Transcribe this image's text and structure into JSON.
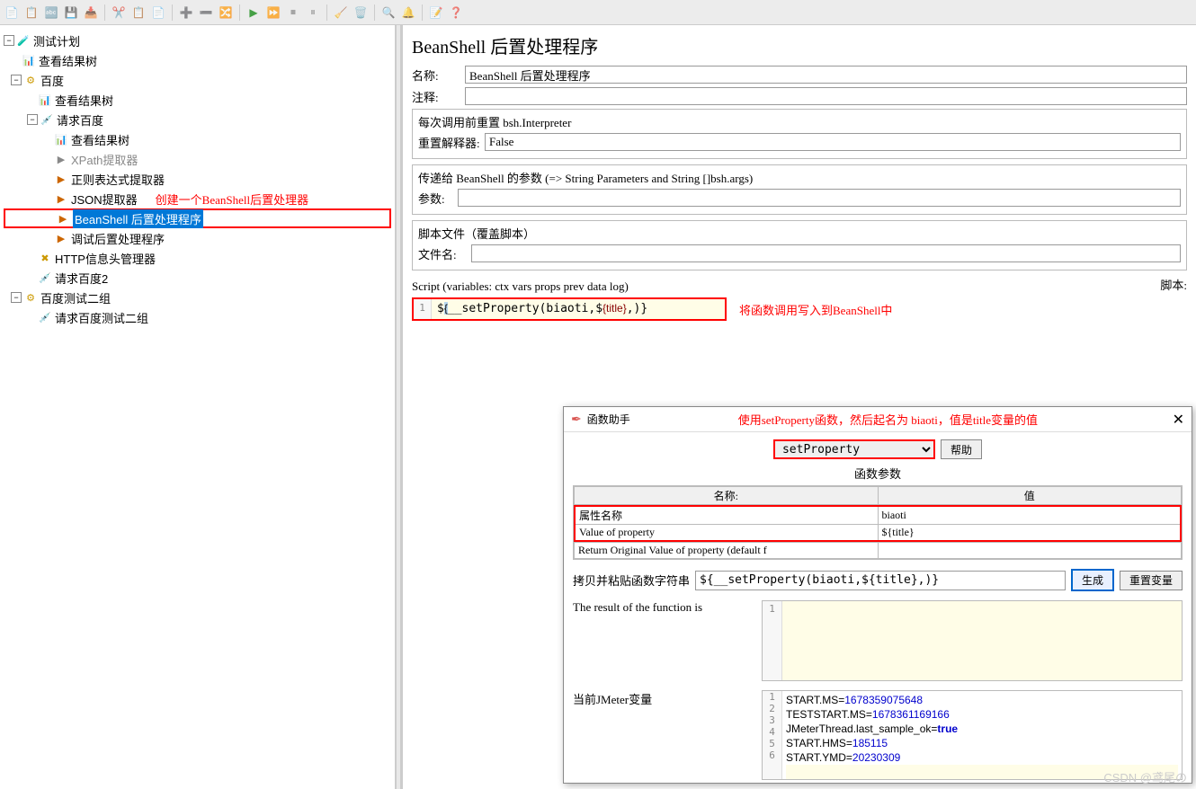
{
  "tree": {
    "root": "测试计划",
    "n1": "查看结果树",
    "n2": "百度",
    "n3": "查看结果树",
    "n4": "请求百度",
    "n5": "查看结果树",
    "n6": "XPath提取器",
    "n7": "正则表达式提取器",
    "n8": "JSON提取器",
    "n9": "BeanShell 后置处理程序",
    "n10": "调试后置处理程序",
    "n11": "HTTP信息头管理器",
    "n12": "请求百度2",
    "n13": "百度测试二组",
    "n14": "请求百度测试二组"
  },
  "annotations": {
    "a1": "创建一个BeanShell后置处理器",
    "a2": "将函数调用写入到BeanShell中",
    "a3": "使用setProperty函数，然后起名为 biaoti，值是title变量的值"
  },
  "panel": {
    "title": "BeanShell 后置处理程序",
    "name_label": "名称:",
    "name_value": "BeanShell 后置处理程序",
    "comment_label": "注释:",
    "comment_value": "",
    "group1_title": "每次调用前重置 bsh.Interpreter",
    "reset_label": "重置解释器:",
    "reset_value": "False",
    "group2_title": "传递给 BeanShell 的参数 (=> String Parameters and String []bsh.args)",
    "params_label": "参数:",
    "group3_title": "脚本文件（覆盖脚本）",
    "file_label": "文件名:",
    "script_label": "Script (variables: ctx vars props prev data log)",
    "script_right": "脚本:",
    "code": "${__setProperty(biaoti,${title},)}"
  },
  "dialog": {
    "title": "函数助手",
    "select_value": "setProperty",
    "help_btn": "帮助",
    "params_title": "函数参数",
    "col_name": "名称:",
    "col_value": "值",
    "row1_name": "属性名称",
    "row1_value": "biaoti",
    "row2_name": "Value of property",
    "row2_value": "${title}",
    "row3_name": "Return Original Value of property (default f",
    "copy_label": "拷贝并粘贴函数字符串",
    "copy_value": "${__setProperty(biaoti,${title},)}",
    "gen_btn": "生成",
    "reset_btn": "重置变量",
    "result_label": "The result of the function is",
    "vars_label": "当前JMeter变量",
    "var1": "START.MS=1678359075648",
    "var2": "TESTSTART.MS=1678361169166",
    "var3": "JMeterThread.last_sample_ok=true",
    "var4": "START.HMS=185115",
    "var5": "START.YMD=20230309"
  },
  "watermark": "CSDN @鸢尾の"
}
